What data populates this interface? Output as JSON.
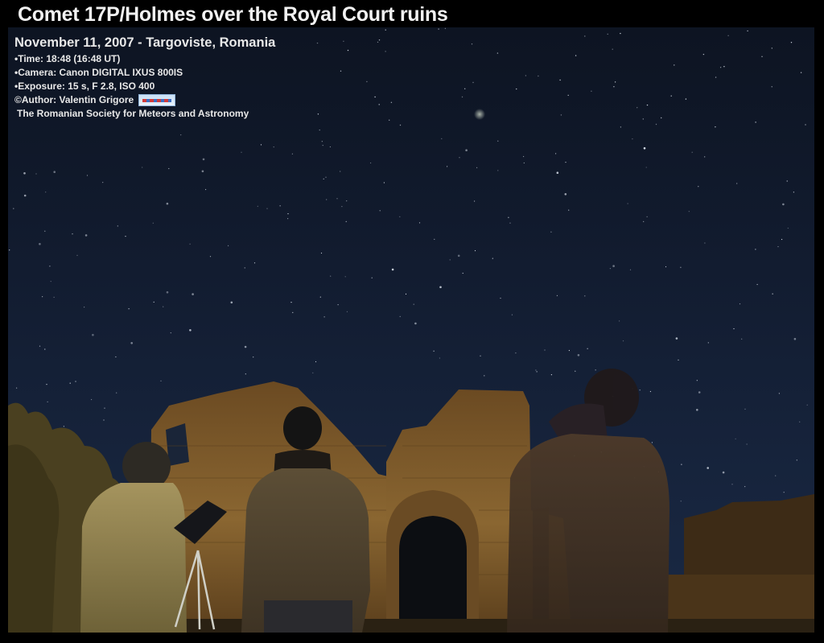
{
  "title": "Comet 17P/Holmes  over the Royal Court ruins",
  "caption": {
    "headline": "November 11, 2007 - Targoviste, Romania",
    "time": "•Time: 18:48  (16:48 UT)",
    "camera": "•Camera: Canon DIGITAL IXUS 800IS",
    "exposure": "•Exposure: 15 s, F 2.8, ISO 400",
    "author": "©Author: Valentin Grigore",
    "society": "The Romanian Society for Meteors and Astronomy"
  },
  "colors": {
    "sky_top": "#0d1422",
    "sky_bottom": "#1a2944",
    "brick": "#7a5a2c",
    "foliage": "#4a4020",
    "caption_text": "#e8e8e8"
  }
}
